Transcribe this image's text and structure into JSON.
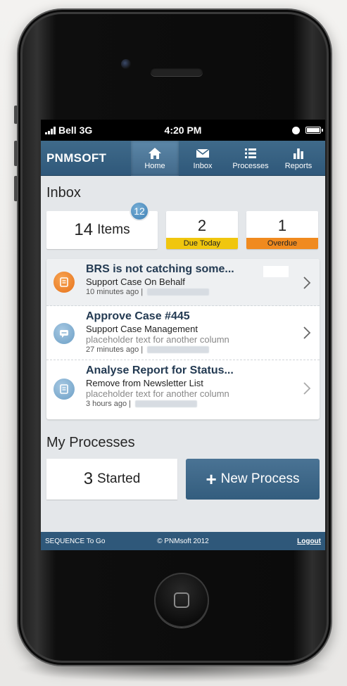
{
  "status": {
    "carrier": "Bell 3G",
    "time": "4:20 PM"
  },
  "nav": {
    "logo": "PNMSOFT",
    "items": [
      {
        "label": "Home",
        "icon": "home-icon",
        "active": true
      },
      {
        "label": "Inbox",
        "icon": "envelope-icon"
      },
      {
        "label": "Processes",
        "icon": "list-icon"
      },
      {
        "label": "Reports",
        "icon": "bar-chart-icon"
      }
    ]
  },
  "inbox": {
    "title": "Inbox",
    "items_count": "14",
    "items_label": "Items",
    "badge": "12",
    "due_today_count": "2",
    "due_today_label": "Due Today",
    "overdue_count": "1",
    "overdue_label": "Overdue",
    "colors": {
      "due_today": "#f0c60e",
      "overdue": "#f08a1f"
    }
  },
  "tasks": [
    {
      "title": "BRS is not catching some...",
      "subtitle": "Support Case On Behalf",
      "meta": "10 minutes ago  |",
      "icon": "document-icon"
    },
    {
      "title": "Approve Case #445",
      "subtitle": "Support Case Management",
      "placeholder": "placeholder text for another column",
      "meta": "27 minutes ago  |",
      "icon": "chat-bubble-icon"
    },
    {
      "title": "Analyse Report for Status...",
      "subtitle": "Remove from Newsletter List",
      "placeholder": "placeholder text for another column",
      "meta": "3 hours ago  |",
      "icon": "document-icon"
    }
  ],
  "processes": {
    "title": "My Processes",
    "started_count": "3",
    "started_label": "Started",
    "new_label": "New Process"
  },
  "footer": {
    "app": "SEQUENCE To Go",
    "copyright": "© PNMsoft 2012",
    "logout": "Logout"
  },
  "theme": {
    "navbar": "#2f587a",
    "accent": "#3e80b5"
  }
}
